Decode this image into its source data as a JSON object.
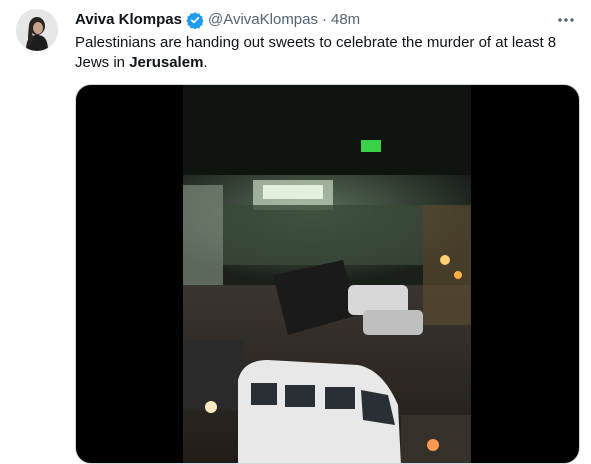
{
  "tweet": {
    "author_name": "Aviva Klompas",
    "handle": "@AvivaKlompas",
    "separator": "·",
    "time": "48m",
    "text_before": "Palestinians are handing out sweets to celebrate the murder of at least 8 Jews in ",
    "text_bold": "Jerusalem",
    "text_after": ".",
    "icons": {
      "verified": "verified-badge-icon",
      "more": "more-options-icon"
    }
  },
  "colors": {
    "text": "#0f1419",
    "secondary": "#536471",
    "verified": "#1d9bf0",
    "media_bg": "#000000"
  }
}
